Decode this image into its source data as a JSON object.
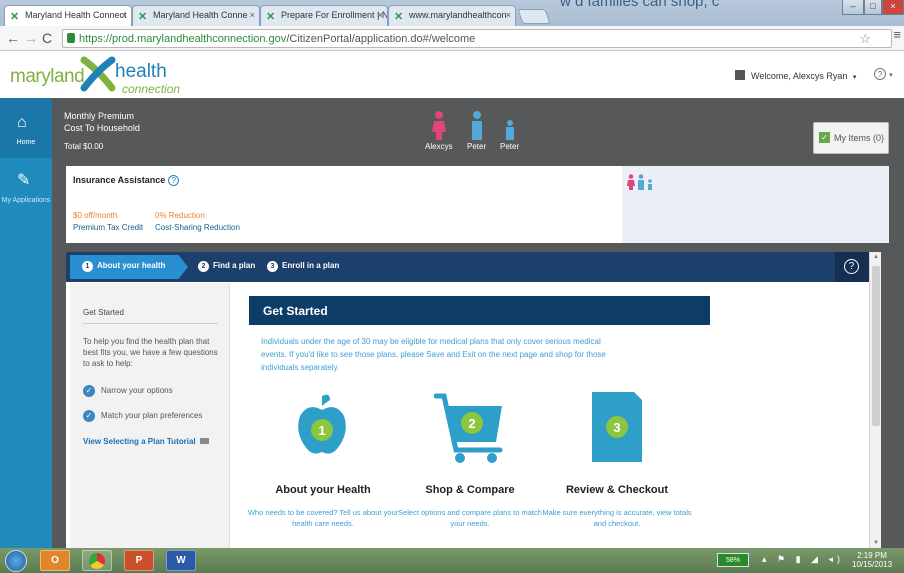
{
  "browser": {
    "background_text": "w       d families can shop, c",
    "tabs": [
      {
        "title": "Maryland Health Connect",
        "active": true
      },
      {
        "title": "Maryland Health Conne",
        "active": false
      },
      {
        "title": "Prepare For Enrollment | N",
        "active": false
      },
      {
        "title": "www.marylandhealthcon",
        "active": false
      }
    ],
    "close_glyph": "×",
    "url_host": "https://prod.marylandhealthconnection.gov",
    "url_path": "/CitizenPortal/application.do#/welcome",
    "window_controls": [
      "–",
      "□",
      "×"
    ]
  },
  "header": {
    "logo_maryland": "maryland",
    "logo_health": "health",
    "logo_connection": "connection",
    "welcome_text": "Welcome, Alexcys Ryan",
    "welcome_caret": "▾",
    "help_glyph": "?",
    "help_caret": "▾"
  },
  "leftnav": {
    "items": [
      {
        "label": "Home",
        "icon": "home-icon"
      },
      {
        "label": "My Applications",
        "icon": "applications-icon"
      }
    ]
  },
  "summary": {
    "premium_line1": "Monthly Premium",
    "premium_line2": "Cost To Household",
    "total": "Total $0.00",
    "members": [
      {
        "name": "Alexcys",
        "color": "#e0457b"
      },
      {
        "name": "Peter",
        "color": "#56a8d8"
      },
      {
        "name": "Peter",
        "color": "#56a8d8"
      }
    ],
    "my_items": "My Items (0)"
  },
  "insurance": {
    "title": "Insurance Assistance",
    "help_glyph": "?",
    "tax_credit_value": "$0 off/month",
    "tax_credit_label": "Premium Tax Credit",
    "reduction_value": "0% Reduction",
    "reduction_label": "Cost-Sharing Reduction"
  },
  "wizard": {
    "steps": [
      {
        "num": "1",
        "label": "About your health"
      },
      {
        "num": "2",
        "label": "Find a plan"
      },
      {
        "num": "3",
        "label": "Enroll in a plan"
      }
    ],
    "help_glyph": "?"
  },
  "sidepanel": {
    "title": "Get Started",
    "text": "To help you find the health plan that best fits you, we have a few questions to ask to help:",
    "checks": [
      "Narrow your options",
      "Match your plan preferences"
    ],
    "check_glyph": "✓",
    "link": "View Selecting a Plan Tutorial"
  },
  "main": {
    "header": "Get Started",
    "intro": "Individuals under the age of 30 may be eligible for medical plans that only cover serious medical events. If you'd like to see those plans, please Save and Exit on the next page and shop for those individuals separately.",
    "cards": [
      {
        "num": "1",
        "title": "About your Health",
        "desc": "Who needs to be covered? Tell us about your health care needs."
      },
      {
        "num": "2",
        "title": "Shop & Compare",
        "desc": "Select options and compare plans to match your needs."
      },
      {
        "num": "3",
        "title": "Review & Checkout",
        "desc": "Make sure everything is accurate, view totals and checkout."
      }
    ]
  },
  "taskbar": {
    "apps": [
      "O",
      "",
      "P",
      "W"
    ],
    "battery": "58%",
    "time": "2:19 PM",
    "date": "10/15/2013"
  },
  "colors": {
    "nav_blue": "#1f8bbd",
    "dark_bg": "#56585a",
    "steps_bar": "#1c3f6b",
    "step_active": "#2a8fd0",
    "card_teal": "#2e9fc9",
    "card_badge": "#8cc63f",
    "orange": "#e8822c"
  }
}
